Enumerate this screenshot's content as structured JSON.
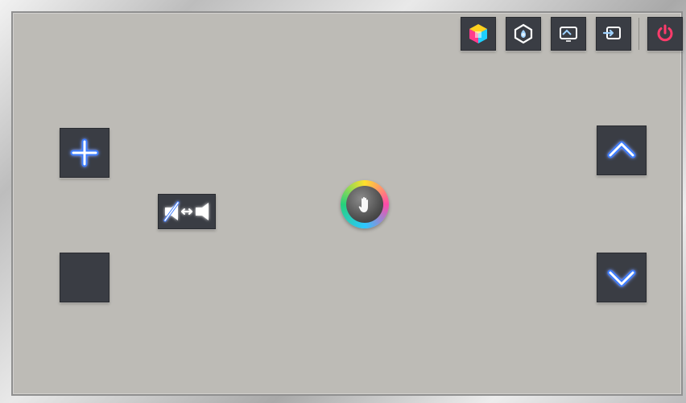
{
  "window": {
    "title": ""
  },
  "top_bar": {
    "buttons": [
      {
        "id": "smart-hub",
        "icon": "smart-hub-cube-icon",
        "tooltip": "",
        "accent": "#3a3d44"
      },
      {
        "id": "source-settings",
        "icon": "hexagon-hand-icon",
        "tooltip": "",
        "accent": "#3a3d44"
      },
      {
        "id": "screen-mirror",
        "icon": "screen-mirror-icon",
        "tooltip": "",
        "accent": "#3a3d44"
      },
      {
        "id": "input-source",
        "icon": "input-source-icon",
        "tooltip": "",
        "accent": "#3a3d44"
      },
      {
        "id": "power",
        "icon": "power-icon",
        "tooltip": "",
        "accent": "#ff3b6b"
      }
    ]
  },
  "controls": {
    "volume_up_icon": "plus-icon",
    "volume_down_icon": "minus-icon",
    "mute_toggle_icon": "mute-toggle-icon",
    "channel_up_icon": "chevron-up-icon",
    "channel_down_icon": "chevron-down-icon",
    "pointer_icon": "hand-cursor-icon",
    "glow_color": "#3b7bff"
  }
}
